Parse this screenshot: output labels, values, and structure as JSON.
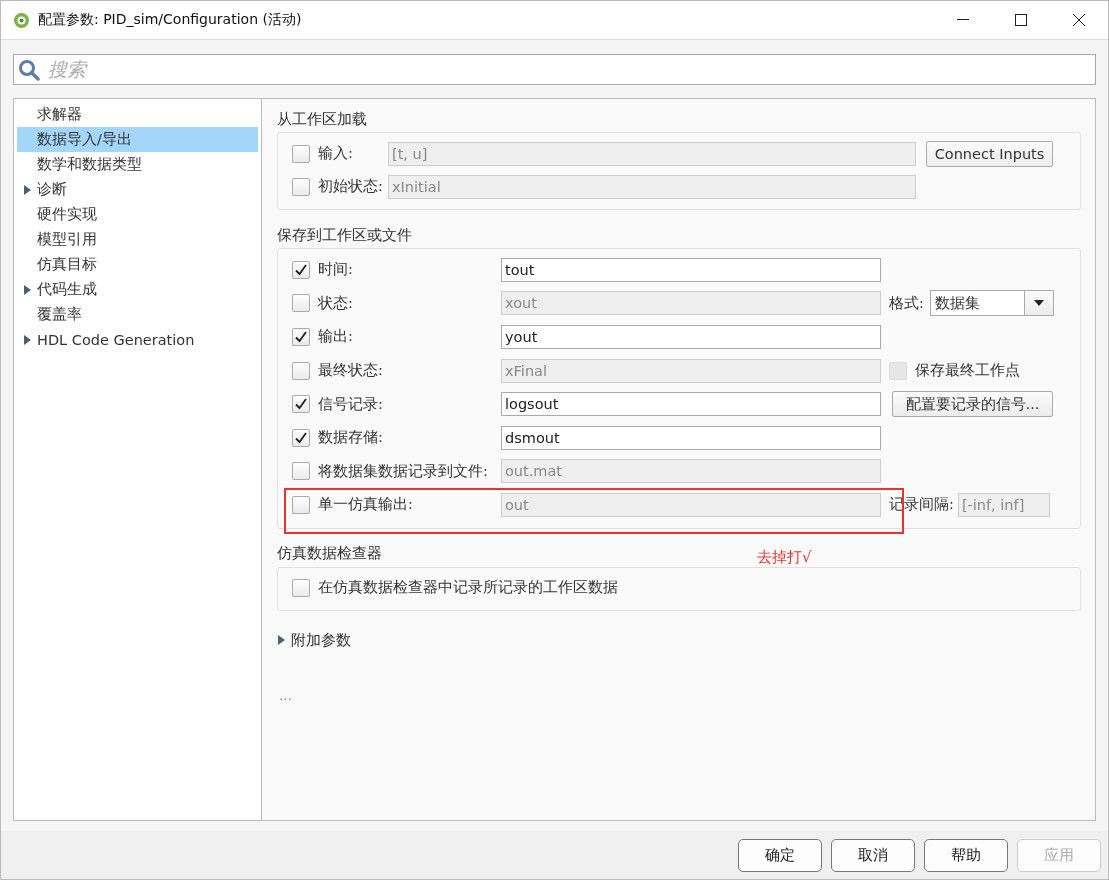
{
  "window": {
    "title": "配置参数: PID_sim/Configuration (活动)"
  },
  "search": {
    "placeholder": "搜索"
  },
  "tree": {
    "items": [
      {
        "label": "求解器",
        "selected": false,
        "expandable": false
      },
      {
        "label": "数据导入/导出",
        "selected": true,
        "expandable": false
      },
      {
        "label": "数学和数据类型",
        "selected": false,
        "expandable": false
      },
      {
        "label": "诊断",
        "selected": false,
        "expandable": true
      },
      {
        "label": "硬件实现",
        "selected": false,
        "expandable": false
      },
      {
        "label": "模型引用",
        "selected": false,
        "expandable": false
      },
      {
        "label": "仿真目标",
        "selected": false,
        "expandable": false
      },
      {
        "label": "代码生成",
        "selected": false,
        "expandable": true
      },
      {
        "label": "覆盖率",
        "selected": false,
        "expandable": false
      },
      {
        "label": "HDL Code Generation",
        "selected": false,
        "expandable": true
      }
    ]
  },
  "sections": [
    {
      "title": "从工作区加载",
      "rows": [
        {
          "label": "输入:",
          "checked": false,
          "value": "[t, u]",
          "extra": {
            "kind": "button",
            "label": "Connect Inputs"
          }
        },
        {
          "label": "初始状态:",
          "checked": false,
          "value": "xInitial"
        }
      ]
    },
    {
      "title": "保存到工作区或文件",
      "rows": [
        {
          "label": "时间:",
          "checked": true,
          "value": "tout",
          "highlighted": false
        },
        {
          "label": "状态:",
          "checked": false,
          "value": "xout",
          "highlighted": false,
          "extra": {
            "kind": "dropdown",
            "label": "格式:",
            "value": "数据集"
          }
        },
        {
          "label": "输出:",
          "checked": true,
          "value": "yout",
          "highlighted": false
        },
        {
          "label": "最终状态:",
          "checked": false,
          "value": "xFinal",
          "highlighted": false,
          "extra": {
            "kind": "checkbox",
            "label": "保存最终工作点",
            "checked": false
          }
        },
        {
          "label": "信号记录:",
          "checked": true,
          "value": "logsout",
          "highlighted": false,
          "extra": {
            "kind": "button",
            "label": "配置要记录的信号..."
          }
        },
        {
          "label": "数据存储:",
          "checked": true,
          "value": "dsmout",
          "highlighted": false
        },
        {
          "label": "将数据集数据记录到文件:",
          "checked": false,
          "value": "out.mat",
          "highlighted": false
        },
        {
          "label": "单一仿真输出:",
          "checked": false,
          "value": "out",
          "highlighted": true,
          "extra": {
            "kind": "field",
            "label": "记录间隔:",
            "value": "[-inf, inf]"
          }
        }
      ]
    },
    {
      "title": "仿真数据检查器",
      "annotation": "去掉打√",
      "rows": [
        {
          "label": "在仿真数据检查器中记录所记录的工作区数据",
          "checked": false
        }
      ]
    }
  ],
  "more": {
    "label": "附加参数",
    "expanded": false
  },
  "footnote": "…",
  "buttons": [
    {
      "label": "确定",
      "disabled": false
    },
    {
      "label": "取消",
      "disabled": false
    },
    {
      "label": "帮助",
      "disabled": false
    },
    {
      "label": "应用",
      "disabled": true
    }
  ]
}
